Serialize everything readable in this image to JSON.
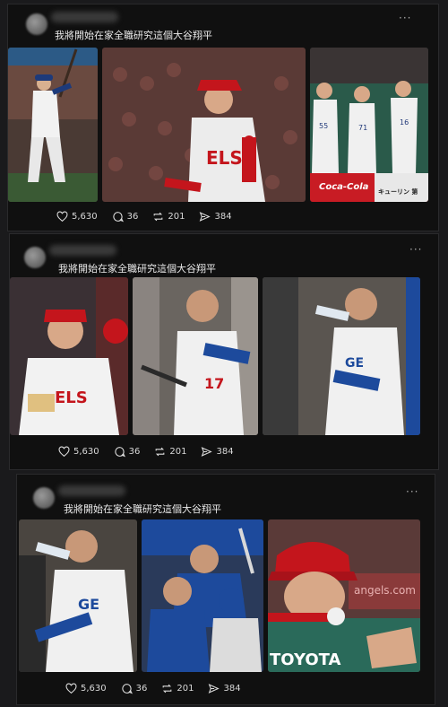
{
  "posts": [
    {
      "caption": "我將開始在家全職研究這個大谷翔平",
      "more": "···",
      "stats": {
        "likes": "5,630",
        "comments": "36",
        "reposts": "201",
        "shares": "384"
      },
      "photos": [
        "batting",
        "pitcher-angels",
        "japan-team-dugout"
      ],
      "sign_text": "Coca-Cola",
      "sign_text2": "キューリン 第"
    },
    {
      "caption": "我將開始在家全職研究這個大谷翔平",
      "more": "···",
      "stats": {
        "likes": "5,630",
        "comments": "36",
        "reposts": "201",
        "shares": "384"
      },
      "photos": [
        "angels-dugout-sitting",
        "dodgers-dugout-bat",
        "dodgers-dugout-drinking"
      ]
    },
    {
      "caption": "我將開始在家全職研究這個大谷翔平",
      "more": "···",
      "stats": {
        "likes": "5,630",
        "comments": "36",
        "reposts": "201",
        "shares": "384"
      },
      "photos": [
        "dodgers-drinking-closeup",
        "dodgers-teammates",
        "angels-cap-closeup"
      ],
      "sign_text": "angels.com",
      "sign_text2": "TOYOTA"
    }
  ],
  "colors": {
    "background": "#1a1a1c",
    "card": "#101010",
    "angels_red": "#c4151c",
    "dodgers_blue": "#1d4a9c"
  }
}
